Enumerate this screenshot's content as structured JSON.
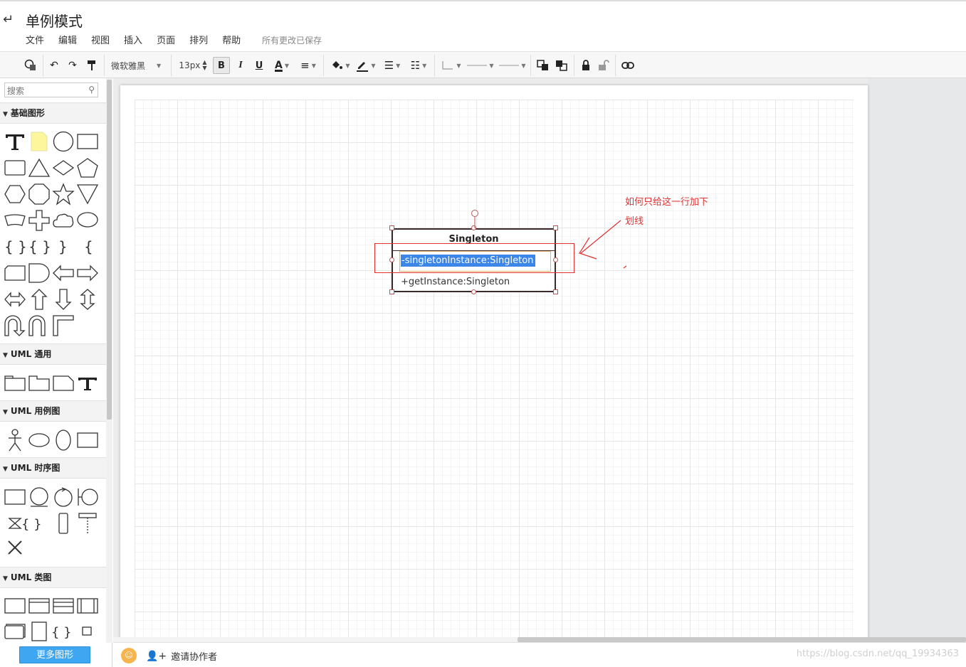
{
  "header": {
    "title": "单例模式",
    "menus": [
      "文件",
      "编辑",
      "视图",
      "插入",
      "页面",
      "排列",
      "帮助"
    ],
    "save_status": "所有更改已保存"
  },
  "toolbar": {
    "font_name": "微软雅黑",
    "font_size": "13px",
    "bold": "B",
    "italic": "I",
    "underline": "U",
    "font_color": "A"
  },
  "sidebar": {
    "search_placeholder": "搜索",
    "categories": [
      "基础图形",
      "UML 通用",
      "UML 用例图",
      "UML 时序图",
      "UML 类图"
    ],
    "more_shapes": "更多图形"
  },
  "canvas": {
    "uml_class": {
      "name": "Singleton",
      "attribute": "-singletonInstance:Singleton",
      "operation": "+getInstance:Singleton"
    },
    "annotation_line1": "如何只给这一行加下",
    "annotation_line2": "划线"
  },
  "footer": {
    "invite": "邀请协作者",
    "watermark": "https://blog.csdn.net/qq_19934363"
  },
  "colors": {
    "accent": "#3fa6f2",
    "selection": "#3b86e8",
    "annotation": "#e03030"
  }
}
